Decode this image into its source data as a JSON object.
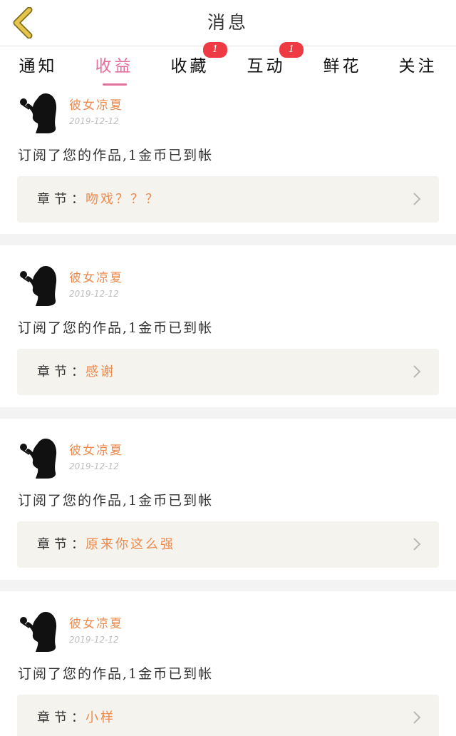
{
  "header": {
    "title": "消息",
    "back_icon": "chevron-left-icon",
    "back_color": "#e6c64a"
  },
  "tabs": [
    {
      "label": "通知",
      "active": false,
      "badge": null
    },
    {
      "label": "收益",
      "active": true,
      "badge": null
    },
    {
      "label": "收藏",
      "active": false,
      "badge": "1"
    },
    {
      "label": "互动",
      "active": false,
      "badge": "1"
    },
    {
      "label": "鲜花",
      "active": false,
      "badge": null
    },
    {
      "label": "关注",
      "active": false,
      "badge": null
    }
  ],
  "colors": {
    "active_tab": "#e46f9a",
    "badge": "#ee3a43",
    "accent_orange": "#ef8a4c",
    "chapter_bg": "#f4f3ee"
  },
  "messages": [
    {
      "username": "彼女凉夏",
      "date": "2019-12-12",
      "text": "订阅了您的作品,1金币已到帐",
      "chapter_label": "章节：",
      "chapter_title": "吻戏？？？"
    },
    {
      "username": "彼女凉夏",
      "date": "2019-12-12",
      "text": "订阅了您的作品,1金币已到帐",
      "chapter_label": "章节：",
      "chapter_title": "感谢"
    },
    {
      "username": "彼女凉夏",
      "date": "2019-12-12",
      "text": "订阅了您的作品,1金币已到帐",
      "chapter_label": "章节：",
      "chapter_title": "原来你这么强"
    },
    {
      "username": "彼女凉夏",
      "date": "2019-12-12",
      "text": "订阅了您的作品,1金币已到帐",
      "chapter_label": "章节：",
      "chapter_title": "小样"
    }
  ]
}
